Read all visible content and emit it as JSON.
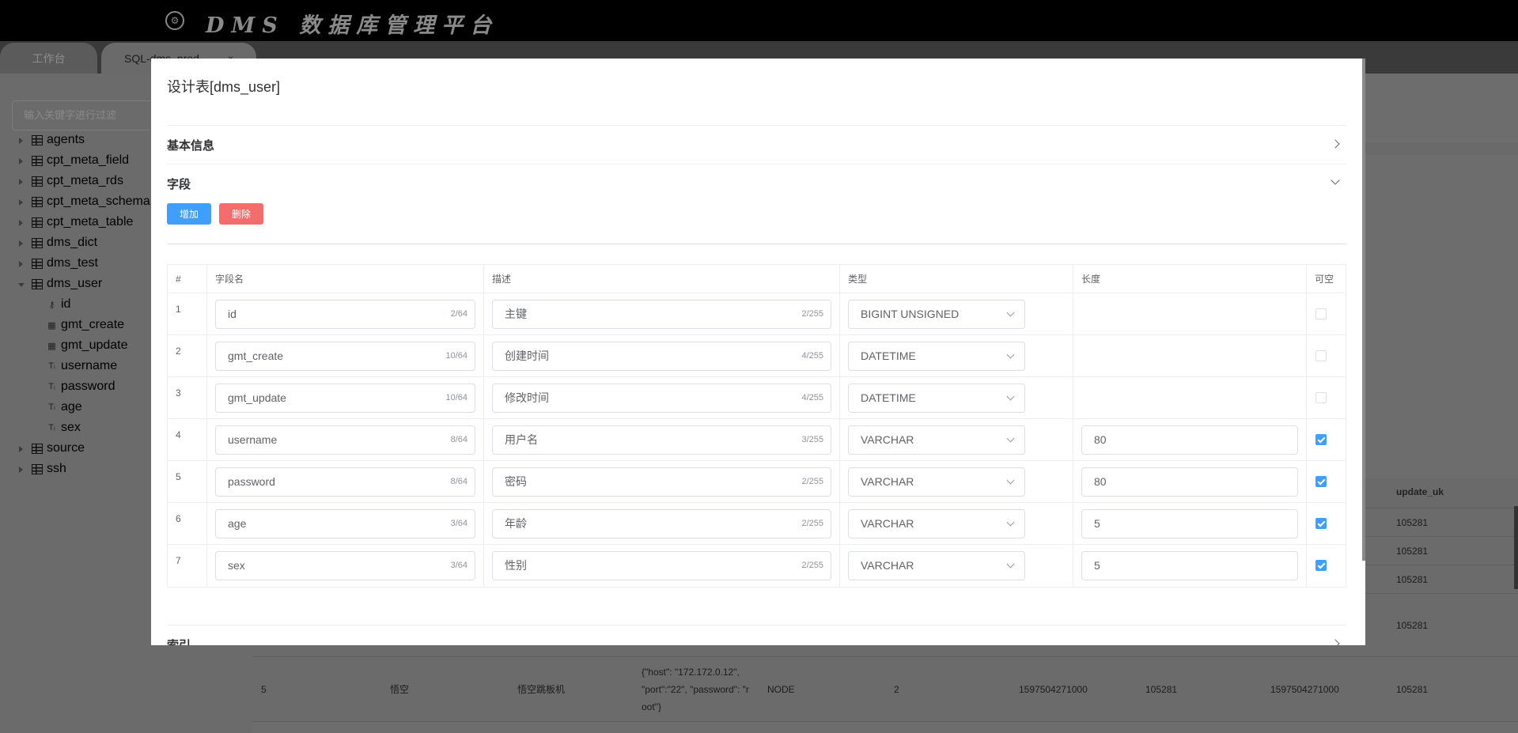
{
  "app": {
    "title": "DMS 数据库管理平台"
  },
  "tabs": [
    {
      "label": "工作台"
    },
    {
      "label": "SQL-dms_prod",
      "close": "×"
    }
  ],
  "sidebar": {
    "filter_placeholder": "输入关键字进行过滤",
    "tree": [
      {
        "label": "agents",
        "expanded": false
      },
      {
        "label": "cpt_meta_field",
        "expanded": false
      },
      {
        "label": "cpt_meta_rds",
        "expanded": false
      },
      {
        "label": "cpt_meta_schema",
        "expanded": false
      },
      {
        "label": "cpt_meta_table",
        "expanded": false
      },
      {
        "label": "dms_dict",
        "expanded": false
      },
      {
        "label": "dms_test",
        "expanded": false
      },
      {
        "label": "dms_user",
        "expanded": true,
        "children": [
          {
            "label": "id",
            "icon": "key-icon"
          },
          {
            "label": "gmt_create",
            "icon": "calendar-icon"
          },
          {
            "label": "gmt_update",
            "icon": "calendar-icon"
          },
          {
            "label": "username",
            "icon": "text-type-icon"
          },
          {
            "label": "password",
            "icon": "text-type-icon"
          },
          {
            "label": "age",
            "icon": "text-type-icon"
          },
          {
            "label": "sex",
            "icon": "text-type-icon"
          }
        ]
      },
      {
        "label": "source",
        "expanded": false
      },
      {
        "label": "ssh",
        "expanded": false
      }
    ]
  },
  "background_table": {
    "visible_header": "update_uk",
    "rows": [
      {
        "update_uk": "105281"
      },
      {
        "update_uk": "105281"
      },
      {
        "update_uk": "105281"
      },
      {
        "update_uk": "105281"
      },
      {
        "id": "5",
        "name": "悟空",
        "desc": "悟空跳板机",
        "config_lines": [
          "{\"host\": \"172.172.0.12\",",
          "\"port\":\"22\", \"password\": \"r",
          "oot\"}"
        ],
        "type": "NODE",
        "col5": "2",
        "gmt_create": "1597504271000",
        "create_uk": "105281",
        "gmt_update": "1597504271000",
        "update_uk": "105281"
      }
    ]
  },
  "modal": {
    "title": "设计表[dms_user]",
    "sections": {
      "basic": "基本信息",
      "fields": "字段",
      "index": "索引"
    },
    "buttons": {
      "add": "增加",
      "delete": "删除"
    },
    "columns": {
      "num": "#",
      "name": "字段名",
      "desc": "描述",
      "type": "类型",
      "length": "长度",
      "nullable": "可空"
    },
    "rows": [
      {
        "num": "1",
        "name": "id",
        "name_count": "2/64",
        "desc": "主键",
        "desc_count": "2/255",
        "type": "BIGINT UNSIGNED",
        "length": null,
        "nullable": false
      },
      {
        "num": "2",
        "name": "gmt_create",
        "name_count": "10/64",
        "desc": "创建时间",
        "desc_count": "4/255",
        "type": "DATETIME",
        "length": null,
        "nullable": false
      },
      {
        "num": "3",
        "name": "gmt_update",
        "name_count": "10/64",
        "desc": "修改时间",
        "desc_count": "4/255",
        "type": "DATETIME",
        "length": null,
        "nullable": false
      },
      {
        "num": "4",
        "name": "username",
        "name_count": "8/64",
        "desc": "用户名",
        "desc_count": "3/255",
        "type": "VARCHAR",
        "length": "80",
        "nullable": true
      },
      {
        "num": "5",
        "name": "password",
        "name_count": "8/64",
        "desc": "密码",
        "desc_count": "2/255",
        "type": "VARCHAR",
        "length": "80",
        "nullable": true
      },
      {
        "num": "6",
        "name": "age",
        "name_count": "3/64",
        "desc": "年龄",
        "desc_count": "2/255",
        "type": "VARCHAR",
        "length": "5",
        "nullable": true
      },
      {
        "num": "7",
        "name": "sex",
        "name_count": "3/64",
        "desc": "性别",
        "desc_count": "2/255",
        "type": "VARCHAR",
        "length": "5",
        "nullable": true
      }
    ]
  },
  "colors": {
    "primary": "#409eff",
    "danger": "#f56c6c",
    "topbar": "#000000",
    "overlay": "#6b6b6b"
  }
}
